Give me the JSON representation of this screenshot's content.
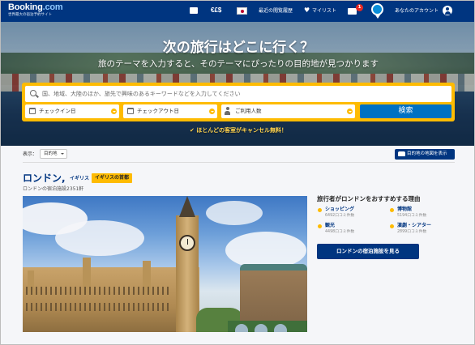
{
  "header": {
    "logo_main": "Booking",
    "logo_suffix": ".com",
    "logo_tagline": "世界最大の宿泊予約サイト",
    "currency": "€£$",
    "recently_viewed": "最近の閲覧履歴",
    "wishlist": "マイリスト",
    "inbox_count": "1",
    "account": "あなたのアカウント"
  },
  "hero": {
    "title": "次の旅行はどこに行く？",
    "subtitle": "旅のテーマを入力すると、そのテーマにぴったりの目的地が見つかります"
  },
  "search": {
    "destination_placeholder": "国、地域、大陸のほか、旅先で興味のあるキーワードなどを入力してください",
    "checkin": "チェックイン日",
    "checkout": "チェックアウト日",
    "guests": "ご利用人数",
    "button": "検索",
    "free_cancel": "ほとんどの客室がキャンセル無料！"
  },
  "toolbar": {
    "display_label": "表示：",
    "display_value": "目的地",
    "map_button": "目的地の地図を表示"
  },
  "city": {
    "name": "ロンドン,",
    "country": "イギリス",
    "badge": "イギリスの首都",
    "property_count": "ロンドンの宿泊施設2351軒"
  },
  "reasons": {
    "title": "旅行者がロンドンをおすすめする理由",
    "items": [
      {
        "name": "ショッピング",
        "count": "6492口コミ件数"
      },
      {
        "name": "博物館",
        "count": "5194口コミ件数"
      },
      {
        "name": "観光",
        "count": "4498口コミ件数"
      },
      {
        "name": "演劇・シアター",
        "count": "2899口コミ件数"
      }
    ],
    "button": "ロンドンの宿泊施設を見る"
  },
  "colors": {
    "brand_blue": "#003580",
    "accent_yellow": "#febb02",
    "button_blue": "#0071c2"
  }
}
